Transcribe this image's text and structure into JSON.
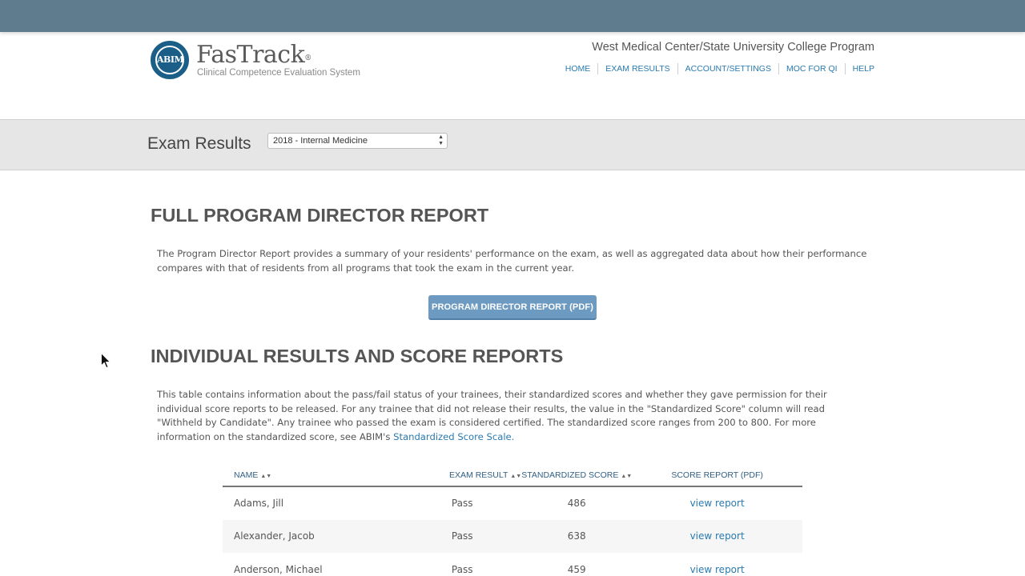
{
  "header": {
    "logo_badge_text": "ABIM",
    "logo_title": "FasTrack",
    "logo_trademark": "®",
    "logo_subtitle": "Clinical Competence Evaluation System",
    "program_name": "West Medical Center/State University College Program",
    "nav": [
      "HOME",
      "EXAM RESULTS",
      "ACCOUNT/SETTINGS",
      "MOC FOR QI",
      "HELP"
    ]
  },
  "band": {
    "title": "Exam Results",
    "exam_select_value": "2018 - Internal Medicine"
  },
  "full_report": {
    "heading": "FULL PROGRAM DIRECTOR REPORT",
    "description": "The Program Director Report provides a summary of your residents' performance on the exam, as well as aggregated data about how their performance compares with that of residents from all programs that took the exam in the current year.",
    "button_label": "PROGRAM DIRECTOR REPORT (PDF)"
  },
  "individual": {
    "heading": "INDIVIDUAL RESULTS AND SCORE REPORTS",
    "description": "This table contains information about the pass/fail status of your trainees, their standardized scores and whether they gave permission for their individual score reports to be released. For any trainee that did not release their results, the value in the \"Standardized Score\" column will read \"Withheld by Candidate\". Any trainee who passed the exam is considered certified. The standardized score ranges from 200 to 800. For more information on the standardized score, see ABIM's ",
    "link_text": "Standardized Score Scale."
  },
  "table": {
    "columns": [
      "NAME",
      "EXAM RESULT",
      "STANDARDIZED SCORE",
      "SCORE REPORT (PDF)"
    ],
    "rows": [
      {
        "name": "Adams, Jill",
        "result": "Pass",
        "score": "486",
        "report": "view report"
      },
      {
        "name": "Alexander, Jacob",
        "result": "Pass",
        "score": "638",
        "report": "view report"
      },
      {
        "name": "Anderson, Michael",
        "result": "Pass",
        "score": "459",
        "report": "view report"
      }
    ]
  },
  "colors": {
    "topbar": "#5f7b8e",
    "link": "#2a7ab0",
    "button": "#6d9ac0"
  }
}
